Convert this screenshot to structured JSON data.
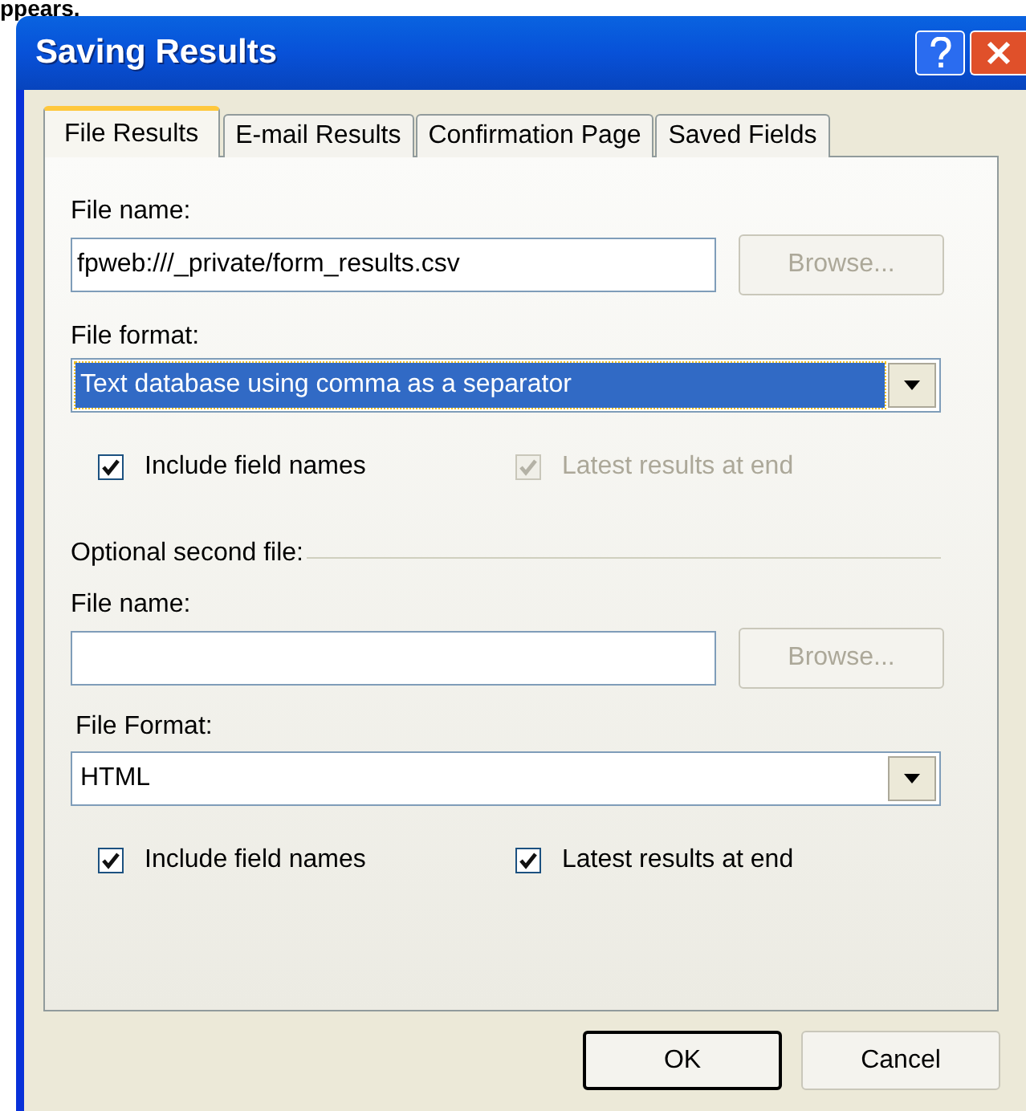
{
  "page_fragment": "ppears.",
  "window": {
    "title": "Saving Results"
  },
  "tabs": [
    {
      "label": "File Results",
      "selected": true
    },
    {
      "label": "E-mail Results",
      "selected": false
    },
    {
      "label": "Confirmation Page",
      "selected": false
    },
    {
      "label": "Saved Fields",
      "selected": false
    }
  ],
  "first_file": {
    "name_label": "File name:",
    "name_value": "fpweb:///_private/form_results.csv",
    "browse": {
      "label": "Browse...",
      "disabled": true
    },
    "format_label": "File format:",
    "format_value": "Text database using comma as a separator",
    "format_focused": true,
    "checkboxes": [
      {
        "label": "Include field names",
        "checked": true,
        "disabled": false
      },
      {
        "label": "Latest results at end",
        "checked": true,
        "disabled": true
      }
    ]
  },
  "second_file": {
    "group_label": "Optional second file:",
    "name_label": "File name:",
    "browse": {
      "label": "Browse...",
      "disabled": true
    },
    "format_label": "File Format:",
    "format_value": "HTML",
    "format_focused": false,
    "checkboxes": [
      {
        "label": "Include field names",
        "checked": true,
        "disabled": false
      },
      {
        "label": "Latest results at end",
        "checked": true,
        "disabled": false
      }
    ]
  },
  "buttons": [
    {
      "label": "OK",
      "default": true
    },
    {
      "label": "Cancel",
      "default": false
    }
  ]
}
